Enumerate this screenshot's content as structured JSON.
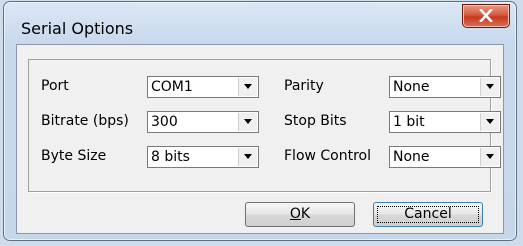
{
  "window": {
    "title": "Serial Options"
  },
  "fields": {
    "port": {
      "label": "Port",
      "value": "COM1"
    },
    "bitrate": {
      "label": "Bitrate (bps)",
      "value": "300"
    },
    "byte_size": {
      "label": "Byte Size",
      "value": "8 bits"
    },
    "parity": {
      "label": "Parity",
      "value": "None"
    },
    "stop_bits": {
      "label": "Stop Bits",
      "value": "1 bit"
    },
    "flow_control": {
      "label": "Flow Control",
      "value": "None"
    }
  },
  "buttons": {
    "ok": {
      "mnemonic": "O",
      "rest": "K"
    },
    "cancel": {
      "label": "Cancel"
    }
  },
  "icons": {
    "close": "close-icon",
    "dropdown": "chevron-down-icon"
  },
  "colors": {
    "close_button": "#d04a2e",
    "frame": "#cfdceb"
  }
}
